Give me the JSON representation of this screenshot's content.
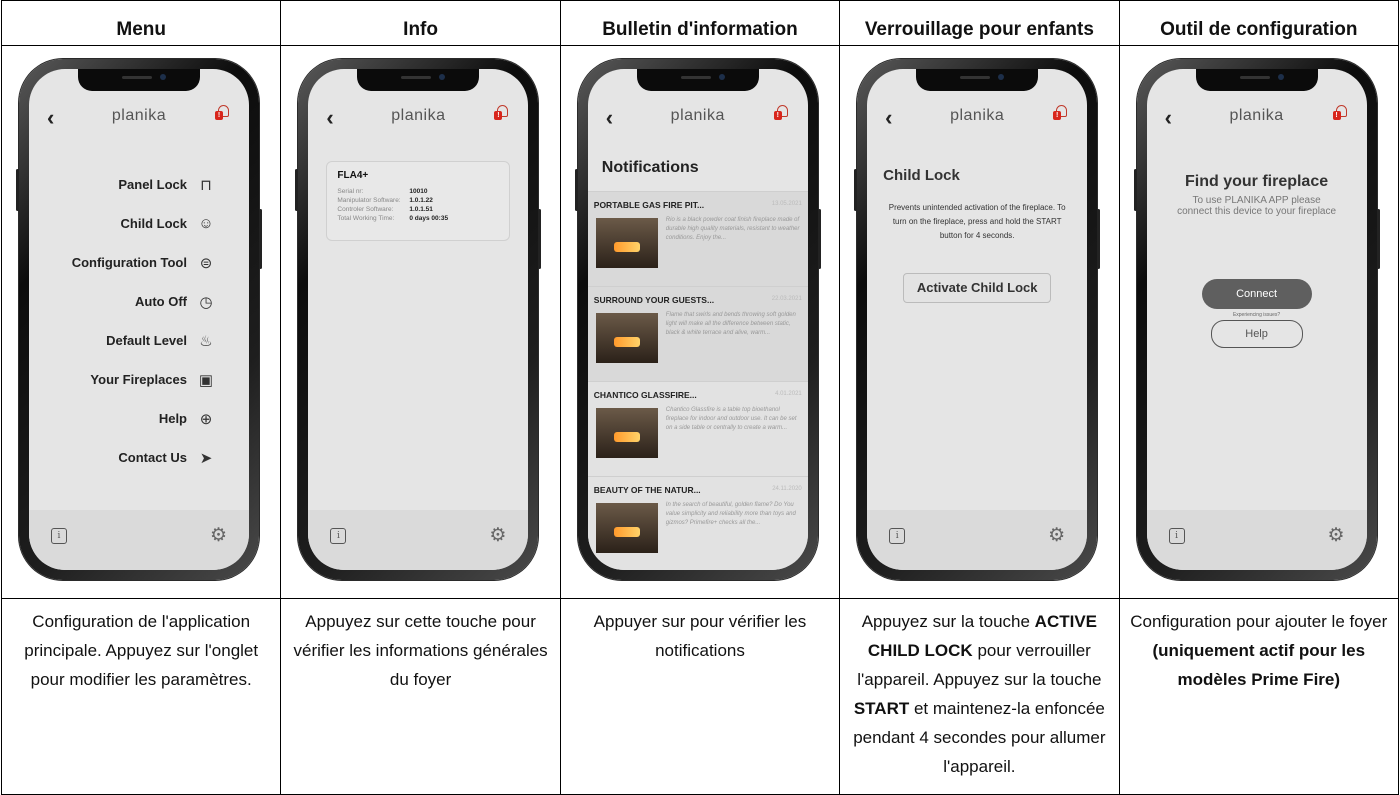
{
  "headers": [
    "Menu",
    "Info",
    "Bulletin d'information",
    "Verrouillage pour enfants",
    "Outil de configuration"
  ],
  "app": {
    "brand": "planika",
    "back_icon": "chevron-left-icon",
    "bell_icon": "bell-icon",
    "info_icon": "info-icon",
    "settings_icon": "gear-icon"
  },
  "menu": {
    "items": [
      {
        "label": "Panel Lock",
        "icon": "lock-icon",
        "glyph": "🔒︎"
      },
      {
        "label": "Child Lock",
        "icon": "baby-icon",
        "glyph": "☺"
      },
      {
        "label": "Configuration Tool",
        "icon": "toggle-icon",
        "glyph": "⚙"
      },
      {
        "label": "Auto Off",
        "icon": "clock-icon",
        "glyph": "◷"
      },
      {
        "label": "Default Level",
        "icon": "flame-icon",
        "glyph": "♨"
      },
      {
        "label": "Your Fireplaces",
        "icon": "fireplace-icon",
        "glyph": "▣"
      },
      {
        "label": "Help",
        "icon": "lifebuoy-icon",
        "glyph": "⊕"
      },
      {
        "label": "Contact Us",
        "icon": "send-icon",
        "glyph": "➤"
      }
    ]
  },
  "info": {
    "model": "FLA4+",
    "rows": [
      {
        "label": "Serial nr:",
        "value": "10010"
      },
      {
        "label": "Manipulator Software:",
        "value": "1.0.1.22"
      },
      {
        "label": "Controler Software:",
        "value": "1.0.1.51"
      },
      {
        "label": "Total Working Time:",
        "value": "0 days  00:35"
      }
    ]
  },
  "notifications": {
    "title": "Notifications",
    "items": [
      {
        "title": "PORTABLE GAS FIRE PIT...",
        "date": "13.05.2021",
        "text": "Rio is a black powder coat finish fireplace made of durable high quality materials, resistant to weather conditions. Enjoy the..."
      },
      {
        "title": "SURROUND YOUR GUESTS...",
        "date": "22.03.2021",
        "text": "Flame that swirls and bends throwing soft golden light will make all the difference between static, black & white terrace and alive, warm..."
      },
      {
        "title": "CHANTICO GLASSFIRE...",
        "date": "4.01.2021",
        "text": "Chantico Glassfire is a table top bioethanol fireplace for indoor and outdoor use. It can be set on a side table or centrally to create a warm..."
      },
      {
        "title": "BEAUTY OF THE NATUR...",
        "date": "24.11.2020",
        "text": "In the search of beautiful, golden flame? Do You value simplicity and reliability more than toys and gizmos? Primefire+ checks all the..."
      }
    ]
  },
  "child_lock": {
    "title": "Child Lock",
    "description": "Prevents unintended activation of the fireplace. To turn on the fireplace, press and hold the START button for 4 seconds.",
    "button": "Activate Child Lock"
  },
  "config": {
    "title": "Find your fireplace",
    "subtitle": "To use PLANIKA APP please connect this device to your fireplace",
    "connect": "Connect",
    "issues": "Experiencing issues?",
    "help": "Help"
  },
  "descriptions": {
    "menu": "Configuration de l'application principale. Appuyez sur l'onglet pour modifier les paramètres.",
    "info": "Appuyez sur cette touche pour vérifier les informations générales du foyer",
    "bulletin": "Appuyer sur pour vérifier les notifications",
    "child_lock": {
      "p1": "Appuyez sur la touche ",
      "b1": "ACTIVE CHILD LOCK",
      "p2": " pour verrouiller l'appareil. Appuyez sur la touche ",
      "b2": "START",
      "p3": " et maintenez-la enfoncée pendant 4 secondes pour allumer l'appareil."
    },
    "config": {
      "p1": "Configuration pour ajouter le foyer ",
      "b1": "(uniquement actif pour les modèles Prime Fire)"
    }
  }
}
